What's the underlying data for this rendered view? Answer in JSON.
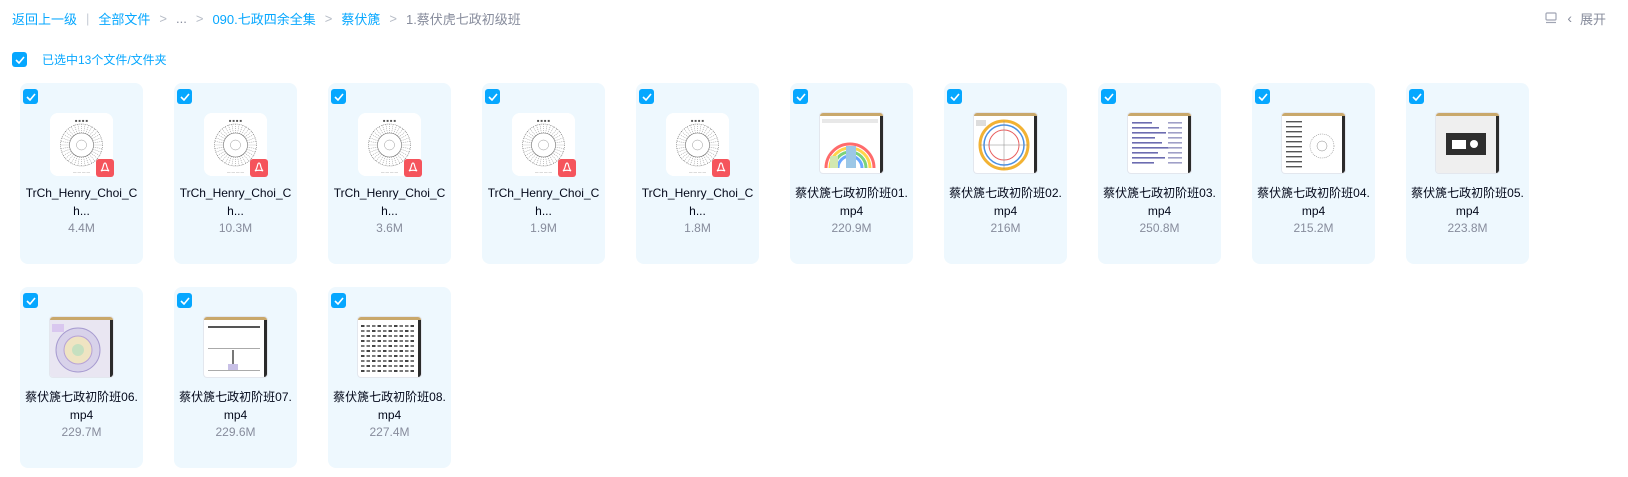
{
  "breadcrumb": {
    "back": "返回上一级",
    "all_files": "全部文件",
    "ellipsis": "...",
    "level1": "090.七政四余全集",
    "level2": "蔡伏篪",
    "current": "1.蔡伏虎七政初级班"
  },
  "top_right": {
    "view_icon": "list-view-icon",
    "expand_label": "展开"
  },
  "selection": {
    "label": "已选中13个文件/文件夹"
  },
  "accent_color": "#06a7ff",
  "pdf_badge_color": "#f5545c",
  "files": [
    {
      "name": "TrCh_Henry_Choi_Ch...",
      "size": "4.4M",
      "kind": "pdf",
      "checked": true
    },
    {
      "name": "TrCh_Henry_Choi_Ch...",
      "size": "10.3M",
      "kind": "pdf",
      "checked": true
    },
    {
      "name": "TrCh_Henry_Choi_Ch...",
      "size": "3.6M",
      "kind": "pdf",
      "checked": true
    },
    {
      "name": "TrCh_Henry_Choi_Ch...",
      "size": "1.9M",
      "kind": "pdf",
      "checked": true
    },
    {
      "name": "TrCh_Henry_Choi_Ch...",
      "size": "1.8M",
      "kind": "pdf",
      "checked": true
    },
    {
      "name": "蔡伏篪七政初阶班01.mp4",
      "size": "220.9M",
      "kind": "video",
      "thumb": "rainbow-chart",
      "checked": true
    },
    {
      "name": "蔡伏篪七政初阶班02.mp4",
      "size": "216M",
      "kind": "video",
      "thumb": "wheel-chart",
      "checked": true
    },
    {
      "name": "蔡伏篪七政初阶班03.mp4",
      "size": "250.8M",
      "kind": "video",
      "thumb": "text-doc",
      "checked": true
    },
    {
      "name": "蔡伏篪七政初阶班04.mp4",
      "size": "215.2M",
      "kind": "video",
      "thumb": "table-wheel",
      "checked": true
    },
    {
      "name": "蔡伏篪七政初阶班05.mp4",
      "size": "223.8M",
      "kind": "video",
      "thumb": "dark-box",
      "checked": true
    },
    {
      "name": "蔡伏篪七政初阶班06.mp4",
      "size": "229.7M",
      "kind": "video",
      "thumb": "color-wheel",
      "checked": true
    },
    {
      "name": "蔡伏篪七政初阶班07.mp4",
      "size": "229.6M",
      "kind": "video",
      "thumb": "slide",
      "checked": true
    },
    {
      "name": "蔡伏篪七政初阶班08.mp4",
      "size": "227.4M",
      "kind": "video",
      "thumb": "dense-table",
      "checked": true
    }
  ]
}
